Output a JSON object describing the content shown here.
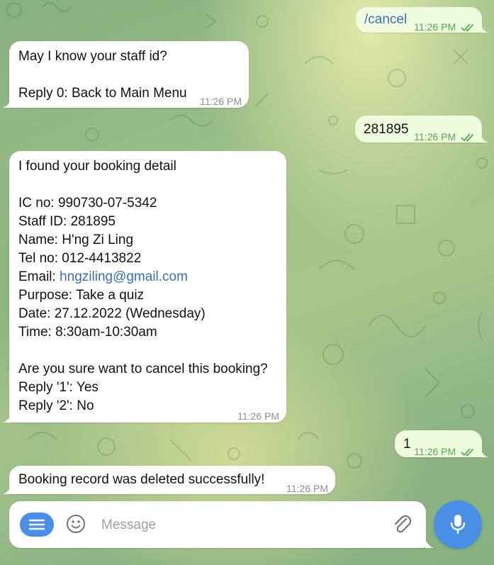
{
  "colors": {
    "accent": "#4a8fe7",
    "outgoing_bubble": "#effdde",
    "incoming_bubble": "#ffffff",
    "time_outgoing": "#4fae4e",
    "time_incoming": "#8f8f8f",
    "link": "#3a6fb5"
  },
  "messages": [
    {
      "direction": "out",
      "text": "/cancel",
      "time": "11:26 PM",
      "status_icon": "double-check-icon"
    },
    {
      "direction": "in",
      "lines": [
        "May I know your staff id?",
        "",
        "Reply 0: Back to Main Menu"
      ],
      "time": "11:26 PM"
    },
    {
      "direction": "out",
      "text": "281895",
      "time": "11:26 PM",
      "status_icon": "double-check-icon"
    },
    {
      "direction": "in",
      "intro": "I found your booking detail",
      "ic": "IC no: 990730-07-5342",
      "staff": "Staff ID: 281895",
      "name": "Name: H'ng Zi Ling",
      "tel": "Tel no: 012-4413822",
      "email_label": "Email: ",
      "email": "hngziling@gmail.com",
      "purpose": "Purpose: Take a quiz",
      "date": "Date: 27.12.2022 (Wednesday)",
      "time_slot": "Time: 8:30am-10:30am",
      "question": "Are you sure want to cancel this booking?",
      "reply1": "Reply '1': Yes",
      "reply2": "Reply '2': No",
      "time": "11:26 PM"
    },
    {
      "direction": "out",
      "text": "1",
      "time": "11:26 PM",
      "status_icon": "double-check-icon"
    },
    {
      "direction": "in",
      "text": "Booking record was deleted successfully!",
      "time": "11:26 PM"
    }
  ],
  "composer": {
    "placeholder": "Message",
    "menu_icon": "menu-icon",
    "emoji_icon": "smiley-icon",
    "attach_icon": "paperclip-icon",
    "send_icon": "microphone-icon"
  }
}
